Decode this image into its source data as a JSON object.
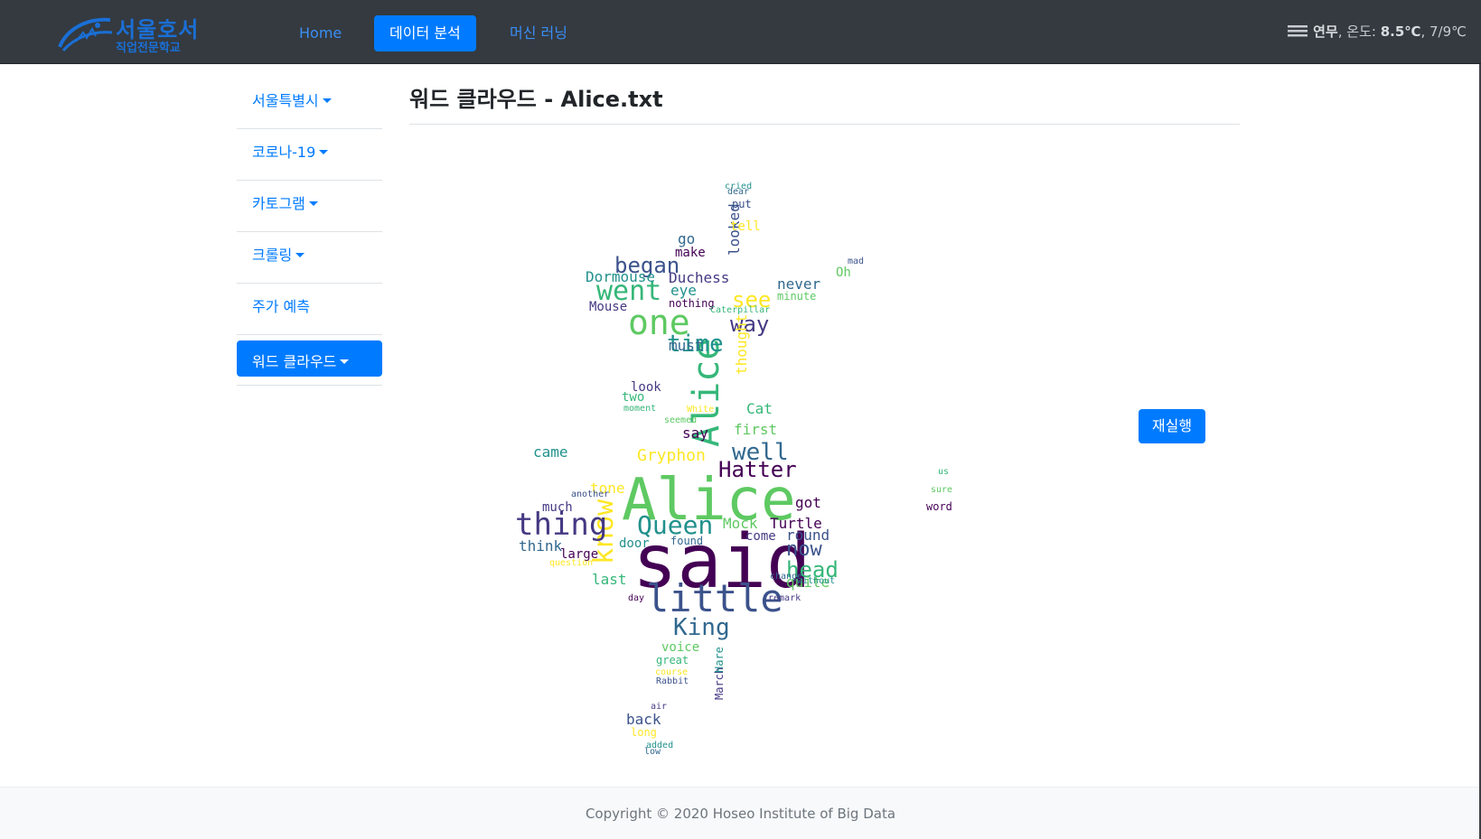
{
  "brand": {
    "name_line1": "서울호서",
    "name_line2": "직업전문학교"
  },
  "nav": {
    "items": [
      {
        "label": "Home"
      },
      {
        "label": "데이터 분석"
      },
      {
        "label": "머신 러닝"
      }
    ]
  },
  "weather": {
    "condition": "연무",
    "temp_label": "온도:",
    "temp": "8.5℃",
    "range": "7/9℃"
  },
  "sidebar": {
    "items": [
      {
        "label": "서울특별시"
      },
      {
        "label": "코로나-19"
      },
      {
        "label": "카토그램"
      },
      {
        "label": "크롤링"
      },
      {
        "label": "주가 예측"
      },
      {
        "label": "워드 클라우드"
      }
    ]
  },
  "main": {
    "title_prefix": "워드 클라우드 -",
    "file_name": "Alice.txt",
    "rerun_label": "재실행"
  },
  "wordcloud": {
    "colors": [
      "#440154",
      "#3b528b",
      "#21918c",
      "#5ec962",
      "#fde725",
      "#31688e",
      "#35b779",
      "#443983"
    ],
    "words": [
      "said",
      "Alice",
      "Alice",
      "little",
      "know",
      "thing",
      "Queen",
      "King",
      "Hatter",
      "one",
      "went",
      "began",
      "see",
      "way",
      "time",
      "well",
      "Turtle",
      "Mock",
      "head",
      "now",
      "Gryphon",
      "Duchess",
      "Dormouse",
      "must",
      "say",
      "first",
      "Cat",
      "looked",
      "thought",
      "Mouse",
      "eye",
      "never",
      "got",
      "quite",
      "last",
      "round",
      "tone",
      "much",
      "came",
      "think",
      "large",
      "voice",
      "great",
      "back",
      "long",
      "March",
      "Hare",
      "go",
      "make",
      "Oh",
      "two",
      "put",
      "tell",
      "come",
      "door",
      "found",
      "nothing",
      "minute",
      "Caterpillar",
      "Rabbit",
      "White",
      "look",
      "cried",
      "dear",
      "word",
      "sure",
      "us",
      "mad",
      "course",
      "air",
      "added",
      "low",
      "day",
      "seemed",
      "moment",
      "another",
      "question",
      "remark",
      "without",
      "change"
    ]
  },
  "footer": {
    "text": "Copyright © 2020 Hoseo Institute of Big Data"
  }
}
